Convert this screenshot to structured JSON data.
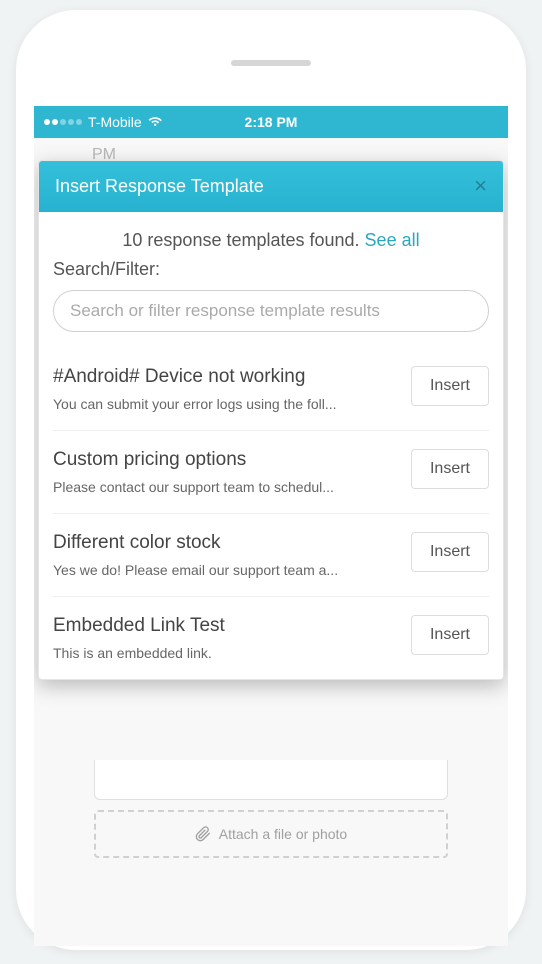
{
  "status_bar": {
    "carrier": "T-Mobile",
    "time": "2:18 PM"
  },
  "background": {
    "pm_label": "PM",
    "attach_label": "Attach a file or photo"
  },
  "modal": {
    "title": "Insert Response Template",
    "found_count_text": "10 response templates found. ",
    "see_all_label": "See all",
    "search_label": "Search/Filter:",
    "search_placeholder": "Search or filter response template results",
    "insert_button_label": "Insert",
    "templates": [
      {
        "title": "#Android# Device not working",
        "desc": "You can submit your error logs using the foll..."
      },
      {
        "title": "Custom pricing options",
        "desc": "Please contact our support team to schedul..."
      },
      {
        "title": "Different color stock",
        "desc": "Yes we do! Please email our support team a..."
      },
      {
        "title": "Embedded Link Test",
        "desc": "This is an embedded link."
      }
    ]
  }
}
